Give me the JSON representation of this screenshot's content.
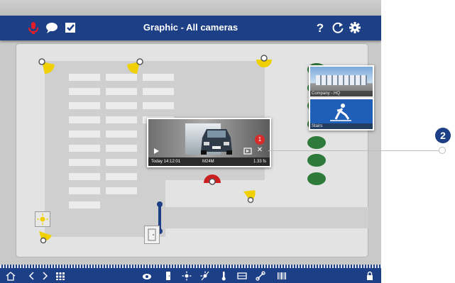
{
  "header": {
    "title": "Graphic - All cameras",
    "left_icons": [
      "microphone-icon",
      "chat-icon",
      "checkbox-icon"
    ],
    "right_icons": [
      "help-icon",
      "refresh-icon",
      "settings-icon"
    ],
    "help_glyph": "?"
  },
  "plan": {
    "thumbnails": [
      {
        "caption": "Company - HQ",
        "icon": "building-photo"
      },
      {
        "caption": "Stairs",
        "icon": "exit-sign"
      }
    ]
  },
  "popup": {
    "timestamp": "Today 14:12:01",
    "camera_name": "M24M",
    "rate": "1.33 fs",
    "badge_count": "1",
    "close_glyph": "✕"
  },
  "bottombar": {
    "left_icons": [
      "home-icon",
      "back-icon",
      "forward-icon",
      "grid-icon"
    ],
    "center_icons": [
      "camera-icon",
      "door-icon",
      "light-icon",
      "light-off-icon",
      "thermometer-icon",
      "film-icon",
      "link-icon",
      "barcode-icon"
    ],
    "right_icons": [
      "lock-icon"
    ]
  },
  "callout": {
    "number": "2"
  },
  "colors": {
    "bar_blue": "#1c3f85",
    "camera_yellow": "#f0d000",
    "camera_red": "#cc1f1f",
    "green_dot": "#2e7a3a",
    "badge_red": "#d72b2b"
  }
}
